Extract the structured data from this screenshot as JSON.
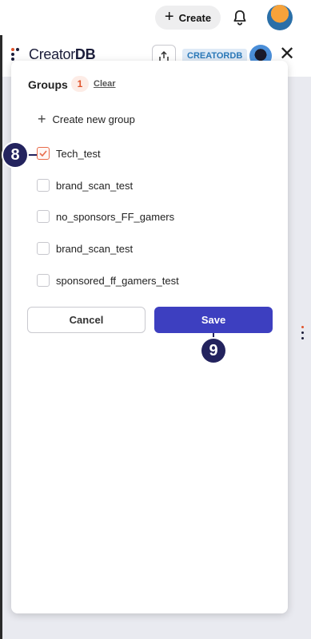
{
  "topbar": {
    "create_label": "Create"
  },
  "header": {
    "logo_prefix": "Creator",
    "logo_suffix": "DB",
    "brand_chip": "CREATORDB"
  },
  "panel": {
    "title": "Groups",
    "count": "1",
    "clear_label": "Clear",
    "create_group_label": "Create new group",
    "groups": [
      {
        "label": "Tech_test",
        "checked": true
      },
      {
        "label": "brand_scan_test",
        "checked": false
      },
      {
        "label": "no_sponsors_FF_gamers",
        "checked": false
      },
      {
        "label": "brand_scan_test",
        "checked": false
      },
      {
        "label": "sponsored_ff_gamers_test",
        "checked": false
      }
    ],
    "cancel_label": "Cancel",
    "save_label": "Save"
  },
  "annotations": {
    "step_checkbox": "8",
    "step_save": "9"
  },
  "colors": {
    "accent": "#3d3fc0",
    "checked": "#e86b4a",
    "step_marker": "#23235e"
  }
}
